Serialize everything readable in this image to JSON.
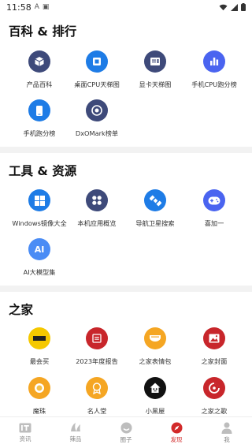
{
  "status": {
    "time": "11:58",
    "indicators": [
      "A",
      "▣"
    ]
  },
  "sections": [
    {
      "title": "百科 & 排行",
      "items": [
        {
          "label": "产品百科",
          "icon": "cube-icon",
          "color": "#3e4a7a"
        },
        {
          "label": "桌面CPU天梯图",
          "icon": "cpu-chip-icon",
          "color": "#1e7ce6"
        },
        {
          "label": "显卡天梯图",
          "icon": "gpu-card-icon",
          "color": "#3e4a7a"
        },
        {
          "label": "手机CPU跑分榜",
          "icon": "bar-chart-icon",
          "color": "#4a64f0"
        },
        {
          "label": "手机跑分榜",
          "icon": "phone-icon",
          "color": "#1e7ce6"
        },
        {
          "label": "DxOMark榜单",
          "icon": "camera-lens-icon",
          "color": "#3e4a7a"
        }
      ]
    },
    {
      "title": "工具 & 资源",
      "items": [
        {
          "label": "Windows镜像大全",
          "icon": "windows-icon",
          "color": "#1e7ce6"
        },
        {
          "label": "本机应用概览",
          "icon": "apps-grid-icon",
          "color": "#3e4a7a"
        },
        {
          "label": "导航卫星搜索",
          "icon": "satellite-icon",
          "color": "#1e7ce6"
        },
        {
          "label": "喜加一",
          "icon": "gamepad-icon",
          "color": "#4a64f0"
        },
        {
          "label": "AI大模型集",
          "icon": "ai-icon",
          "color": "#4a8cf5"
        }
      ]
    },
    {
      "title": "之家",
      "items": [
        {
          "label": "最会买",
          "icon": "zuihuimai-logo-icon",
          "color": "#f5c800"
        },
        {
          "label": "2023年度报告",
          "icon": "report-icon",
          "color": "#c8262b"
        },
        {
          "label": "之家表情包",
          "icon": "sticker-icon",
          "color": "#f5a623"
        },
        {
          "label": "之家封面",
          "icon": "picture-icon",
          "color": "#c8262b"
        },
        {
          "label": "魔珠",
          "icon": "bead-icon",
          "color": "#f5a623"
        },
        {
          "label": "名人堂",
          "icon": "medal-icon",
          "color": "#f5a623"
        },
        {
          "label": "小黑屋",
          "icon": "black-house-icon",
          "color": "#111111"
        },
        {
          "label": "之家之歌",
          "icon": "music-disc-icon",
          "color": "#c8262b"
        }
      ]
    }
  ],
  "tabbar": {
    "active": "发现",
    "tabs": [
      {
        "label": "资讯",
        "icon": "it-news-icon"
      },
      {
        "label": "辣品",
        "icon": "lapin-icon"
      },
      {
        "label": "圈子",
        "icon": "circle-icon"
      },
      {
        "label": "发现",
        "icon": "discover-compass-icon"
      },
      {
        "label": "我",
        "icon": "user-icon"
      }
    ]
  },
  "colors": {
    "accent": "#d22a2a",
    "divider": "#f2f2f2"
  }
}
